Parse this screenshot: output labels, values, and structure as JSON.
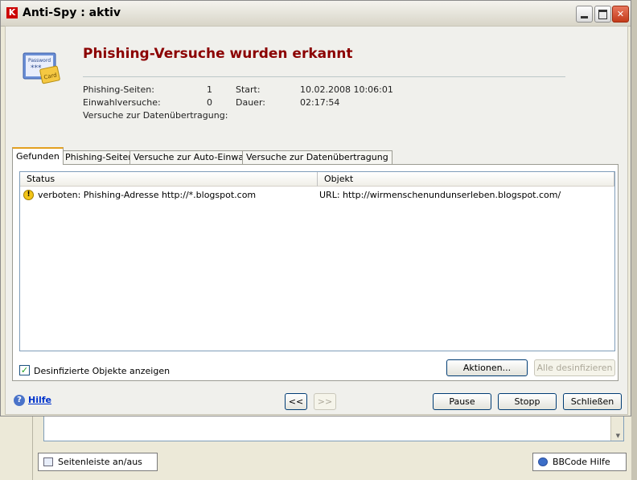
{
  "window": {
    "title": "Anti-Spy : aktiv",
    "minimize_icon": "minimize-icon",
    "maximize_icon": "maximize-icon",
    "close_icon": "close-icon"
  },
  "header": {
    "title": "Phishing-Versuche wurden erkannt",
    "icon": "password-card-icon",
    "title_color": "#8b0000",
    "card_icon_texts": {
      "line1": "Password",
      "line2": "***",
      "line3": "Card"
    }
  },
  "stats": {
    "phishing_label": "Phishing-Seiten:",
    "phishing_value": "1",
    "dialin_label": "Einwahlversuche:",
    "dialin_value": "0",
    "transfer_label": "Versuche zur Datenübertragung:",
    "start_label": "Start:",
    "start_value": "10.02.2008 10:06:01",
    "duration_label": "Dauer:",
    "duration_value": "02:17:54"
  },
  "tabs": [
    {
      "label": "Gefunden",
      "active": true
    },
    {
      "label": "Phishing-Seiten",
      "active": false
    },
    {
      "label": "Versuche zur Auto-Einwahl",
      "active": false
    },
    {
      "label": "Versuche zur Datenübertragung",
      "active": false
    }
  ],
  "table": {
    "columns": [
      "Status",
      "Objekt"
    ],
    "rows": [
      {
        "icon": "warning-icon",
        "status": "verboten: Phishing-Adresse http://*.blogspot.com",
        "object": "URL: http://wirmenschenundunserleben.blogspot.com/"
      }
    ]
  },
  "checkbox": {
    "label": "Desinfizierte Objekte anzeigen",
    "checked": true
  },
  "buttons": {
    "actions": "Aktionen...",
    "disinfect_all": "Alle desinfizieren",
    "prev": "<<",
    "next": ">>",
    "pause": "Pause",
    "stop": "Stopp",
    "close": "Schließen"
  },
  "help": {
    "label": "Hilfe",
    "icon": "help-icon"
  },
  "background": {
    "sidebar_toggle": "Seitenleiste an/aus",
    "bbcode_help": "BBCode Hilfe"
  }
}
